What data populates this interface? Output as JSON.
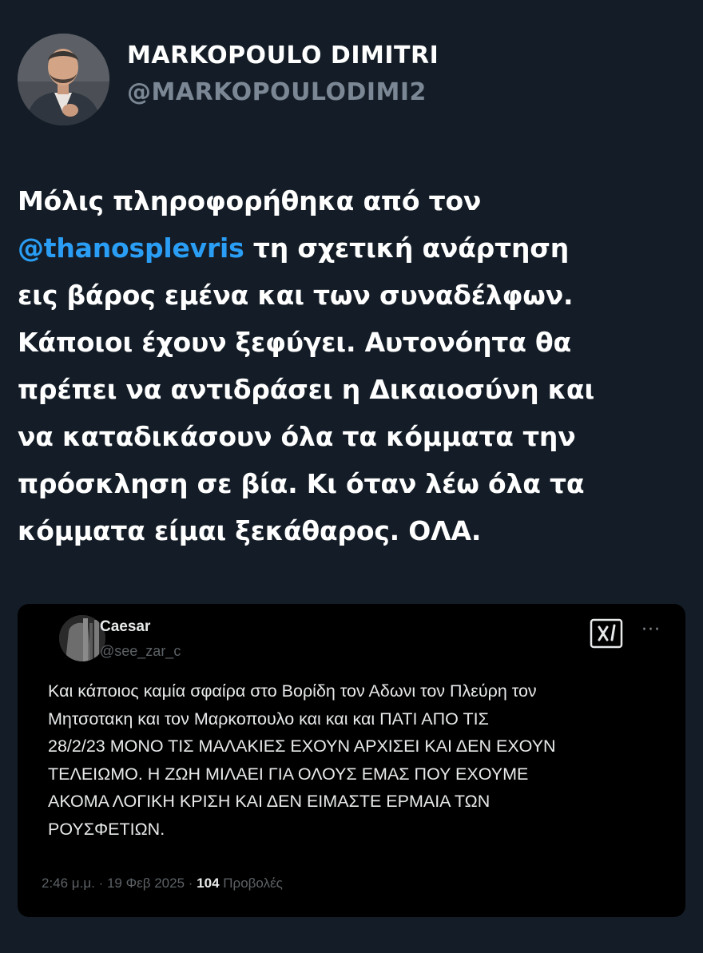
{
  "author": {
    "display_name": "MARKOPOULO DIMITRI",
    "handle": "@MARKOPOULODIMI2"
  },
  "post": {
    "mention": "@thanosplevris",
    "lines": [
      "Μόλις πληροφορήθηκα από τον",
      " τη σχετική ανάρτηση",
      "εις βάρος εμένα και των συναδέλφων.",
      "Κάποιοι έχουν ξεφύγει. Αυτονόητα θα",
      "πρέπει να αντιδράσει η Δικαιοσύνη και",
      "να καταδικάσουν όλα τα κόμματα την",
      "πρόσκληση σε βία. Κι όταν λέω όλα τα",
      "κόμματα είμαι ξεκάθαρος. ΟΛΑ."
    ]
  },
  "quoted_post": {
    "display_name": "Caesar",
    "handle": "@see_zar_c",
    "more_label": "···",
    "lines": [
      "Και κάποιος καμία σφαίρα στο Βορίδη τον Αδωνι τον Πλεύρη τον",
      "Μητσοτακη και τον Μαρκοπουλο και και και ΠΑΤΙ ΑΠΟ ΤΙΣ",
      "28/2/23 ΜΟΝΟ ΤΙΣ ΜΑΛΑΚΙΕΣ ΕΧΟΥΝ ΑΡΧΙΣΕΙ ΚΑΙ ΔΕΝ ΕΧΟΥΝ",
      "ΤΕΛΕΙΩΜΟ. Η ΖΩΗ ΜΙΛΑΕΙ ΓΙΑ ΟΛΟΥΣ ΕΜΑΣ ΠΟΥ ΕΧΟΥΜΕ",
      "ΑΚΟΜΑ ΛΟΓΙΚΗ ΚΡΙΣΗ ΚΑΙ ΔΕΝ ΕΙΜΑΣΤΕ ΕΡΜΑΙΑ ΤΩΝ",
      "ΡΟΥΣΦΕΤΙΩΝ."
    ],
    "timestamp": "2:46 μ.μ. · 19 Φεβ 2025 · ",
    "views_count": "104",
    "views_label": " Προβολές"
  },
  "colors": {
    "background": "#141d27",
    "mention": "#2a9df4",
    "handle": "#7b8794",
    "quoted_background": "#000000"
  },
  "icons": {
    "grok": "grok-icon",
    "more": "more-icon"
  }
}
